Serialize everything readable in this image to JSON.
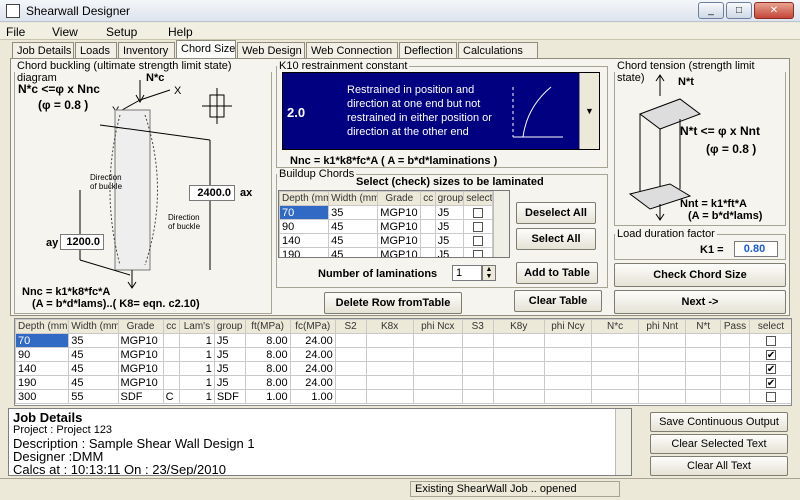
{
  "window": {
    "title": "Shearwall Designer",
    "minimize": "_",
    "maximize": "□",
    "close": "✕"
  },
  "menu": [
    "File",
    "View",
    "Setup",
    "Help"
  ],
  "tabs": [
    "Job Details",
    "Loads",
    "Inventory",
    "Chord Size",
    "Web Design",
    "Web Connection",
    "Deflection",
    "Calculations"
  ],
  "buckling": {
    "legend": "Chord buckling (ultimate strength limit state) diagram",
    "formula1": "N*c <=φ x Nnc",
    "phi": "(φ = 0.8 )",
    "nc": "N*c",
    "ax_value": "2400.0",
    "ax_label": "ax",
    "ay_label": "ay",
    "ay_value": "1200.0",
    "dir1": "Direction of buckle",
    "dir2": "Direction of buckle ( out of plane )",
    "formula2": "Nnc = k1*k8*fc*A",
    "formula3": "(A = b*d*lams)..( K8= eqn. c2.10)"
  },
  "k10": {
    "legend": "K10 restrainment constant",
    "value": "2.0",
    "description": "Restrained in position and direction at one end but not restrained in either position or direction at the other end",
    "formula": "Nnc = k1*k8*fc*A   ( A = b*d*laminations )"
  },
  "buildup": {
    "legend": "Buildup Chords",
    "title": "Select (check) sizes to be laminated",
    "headers": [
      "Depth (mm",
      "Width (mm",
      "Grade",
      "cc",
      "group",
      "select"
    ],
    "rows": [
      [
        "70",
        "35",
        "MGP10",
        "",
        "J5"
      ],
      [
        "90",
        "45",
        "MGP10",
        "",
        "J5"
      ],
      [
        "140",
        "45",
        "MGP10",
        "",
        "J5"
      ],
      [
        "190",
        "45",
        "MGP10",
        "",
        "J5"
      ]
    ],
    "deselect": "Deselect All",
    "select": "Select All",
    "lam_label": "Number of laminations",
    "lam_value": "1",
    "add": "Add to Table",
    "clear": "Clear Table",
    "delete": "Delete Row fromTable"
  },
  "tension": {
    "legend": "Chord tension (strength limit state)",
    "nt": "N*t",
    "formula1": "N*t <= φ x Nnt",
    "phi": "(φ = 0.8 )",
    "formula2": "Nnt = k1*ft*A",
    "formula3": "(A = b*d*lams)"
  },
  "duration": {
    "legend": "Load duration factor",
    "label": "K1 =",
    "value": "0.80"
  },
  "check": "Check Chord Size",
  "next": "Next ->",
  "results": {
    "headers": [
      "Depth (mm)",
      "Width (mm)",
      "Grade",
      "cc",
      "Lam's",
      "group",
      "ft(MPa)",
      "fc(MPa)",
      "S2",
      "K8x",
      "phi Ncx",
      "S3",
      "K8y",
      "phi Ncy",
      "N*c",
      "phi Nnt",
      "N*t",
      "Pass",
      "select"
    ],
    "rows": [
      [
        "70",
        "35",
        "MGP10",
        "",
        "1",
        "J5",
        "8.00",
        "24.00",
        "",
        "",
        "",
        "",
        "",
        "",
        "",
        "",
        "",
        "",
        false
      ],
      [
        "90",
        "45",
        "MGP10",
        "",
        "1",
        "J5",
        "8.00",
        "24.00",
        "",
        "",
        "",
        "",
        "",
        "",
        "",
        "",
        "",
        "",
        true
      ],
      [
        "140",
        "45",
        "MGP10",
        "",
        "1",
        "J5",
        "8.00",
        "24.00",
        "",
        "",
        "",
        "",
        "",
        "",
        "",
        "",
        "",
        "",
        true
      ],
      [
        "190",
        "45",
        "MGP10",
        "",
        "1",
        "J5",
        "8.00",
        "24.00",
        "",
        "",
        "",
        "",
        "",
        "",
        "",
        "",
        "",
        "",
        true
      ],
      [
        "300",
        "55",
        "SDF",
        "C",
        "1",
        "SDF",
        "1.00",
        "1.00",
        "",
        "",
        "",
        "",
        "",
        "",
        "",
        "",
        "",
        "",
        false
      ]
    ]
  },
  "log": {
    "heading": "Job Details",
    "lines": [
      "Project : Project 123",
      "Description : Sample Shear Wall Design 1",
      "Designer :DMM",
      "Calcs at : 10:13:11  On : 23/Sep/2010"
    ]
  },
  "log_buttons": [
    "Save Continuous Output",
    "Clear Selected Text",
    "Clear All Text"
  ],
  "status": "Existing ShearWall Job .. opened"
}
